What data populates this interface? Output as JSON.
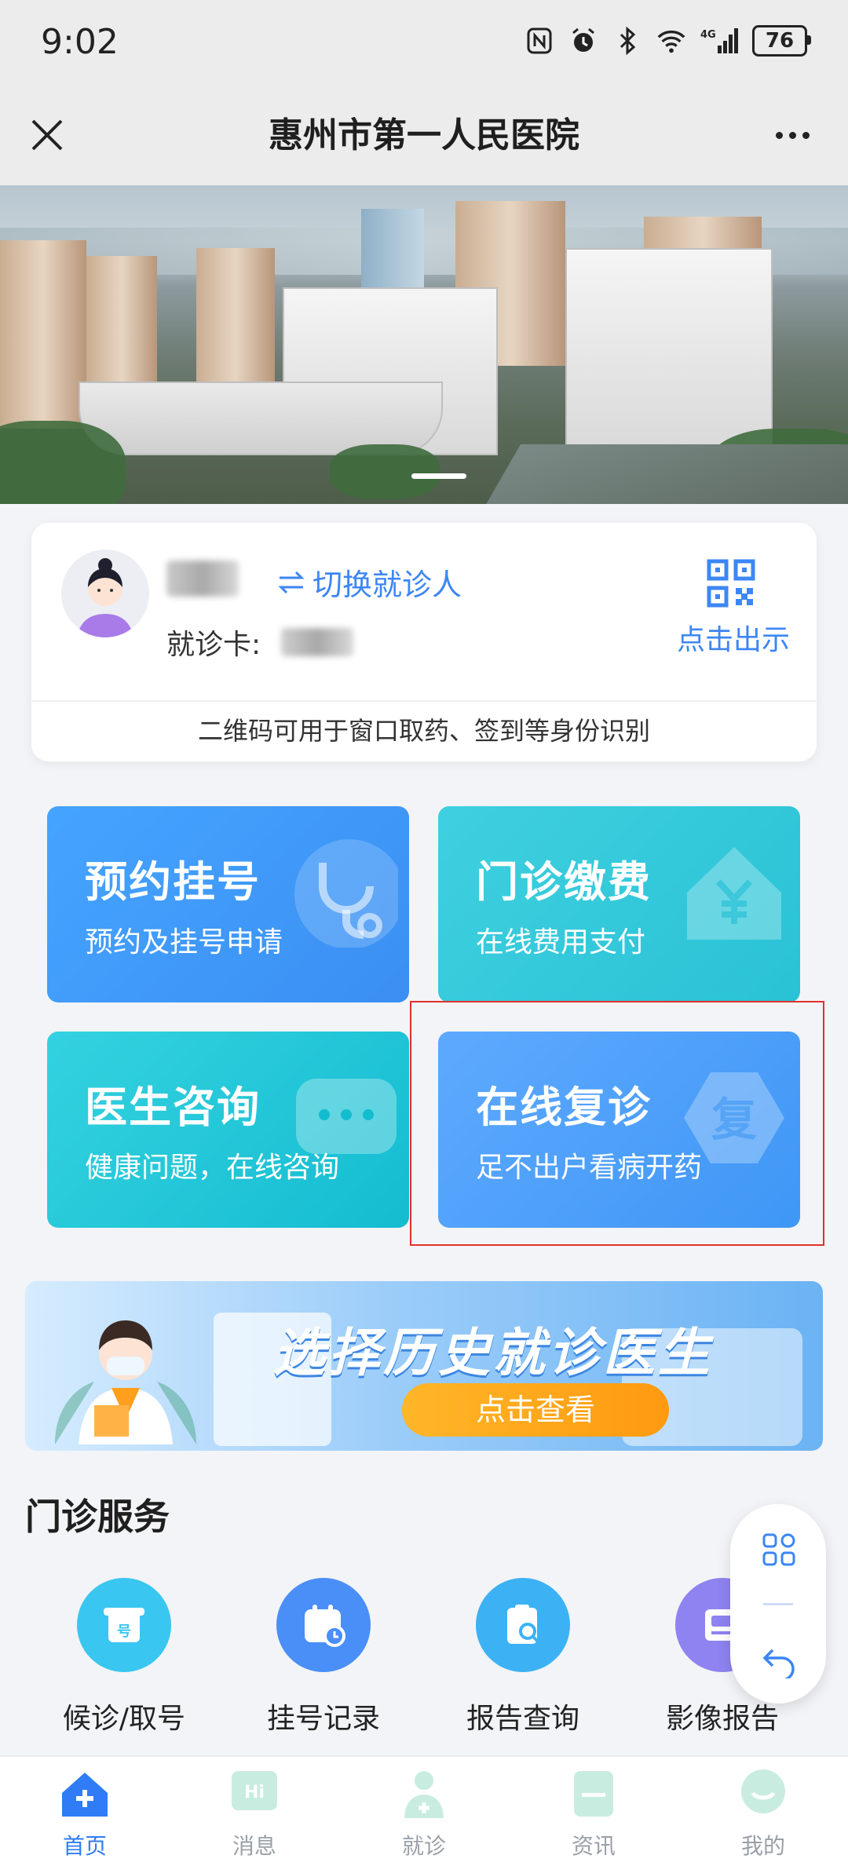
{
  "status_bar": {
    "time": "9:02",
    "battery": "76",
    "network": "4G"
  },
  "header": {
    "title": "惠州市第一人民医院"
  },
  "patient_card": {
    "switch_label": "切换就诊人",
    "card_label": "就诊卡:",
    "qr_label": "点击出示",
    "note": "二维码可用于窗口取药、签到等身份识别"
  },
  "tiles": [
    {
      "title": "预约挂号",
      "subtitle": "预约及挂号申请"
    },
    {
      "title": "门诊缴费",
      "subtitle": "在线费用支付"
    },
    {
      "title": "医生咨询",
      "subtitle": "健康问题，在线咨询"
    },
    {
      "title": "在线复诊",
      "subtitle": "足不出户看病开药",
      "icon_char": "复"
    }
  ],
  "promo": {
    "headline": "选择历史就诊医生",
    "button": "点击查看"
  },
  "section": {
    "title": "门诊服务"
  },
  "services": [
    {
      "label": "候诊/取号",
      "color": "#39c6f0",
      "icon_char": "号"
    },
    {
      "label": "挂号记录",
      "color": "#4a8ef8"
    },
    {
      "label": "报告查询",
      "color": "#3cb2f5"
    },
    {
      "label": "影像报告",
      "color": "#8e83f0"
    }
  ],
  "bottom_nav": [
    {
      "label": "首页",
      "active": true
    },
    {
      "label": "消息",
      "icon_char": "Hi"
    },
    {
      "label": "就诊"
    },
    {
      "label": "资讯"
    },
    {
      "label": "我的"
    }
  ],
  "colors": {
    "accent": "#3d86f5",
    "highlight_border": "#e0302b"
  }
}
